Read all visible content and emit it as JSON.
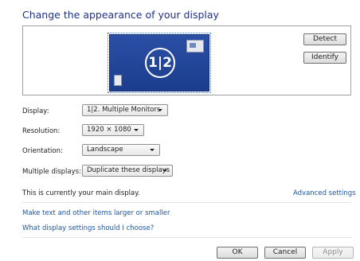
{
  "page": {
    "title": "Change the appearance of your display"
  },
  "monitors": {
    "badge": "1|2",
    "detect_label": "Detect",
    "identify_label": "Identify"
  },
  "settings": {
    "display": {
      "label": "Display:",
      "value": "1|2. Multiple Monitors"
    },
    "resolution": {
      "label": "Resolution:",
      "value": "1920 × 1080"
    },
    "orientation": {
      "label": "Orientation:",
      "value": "Landscape"
    },
    "multiple_displays": {
      "label": "Multiple displays:",
      "value": "Duplicate these displays"
    }
  },
  "status": {
    "main_display_text": "This is currently your main display.",
    "advanced_settings_link": "Advanced settings"
  },
  "links": {
    "text_size": "Make text and other items larger or smaller",
    "help": "What display settings should I choose?"
  },
  "footer": {
    "ok_label": "OK",
    "cancel_label": "Cancel",
    "apply_label": "Apply",
    "apply_enabled": false
  },
  "colors": {
    "title": "#1e3287",
    "link": "#1c57a4",
    "monitor_fill": "#2b4fa6"
  }
}
